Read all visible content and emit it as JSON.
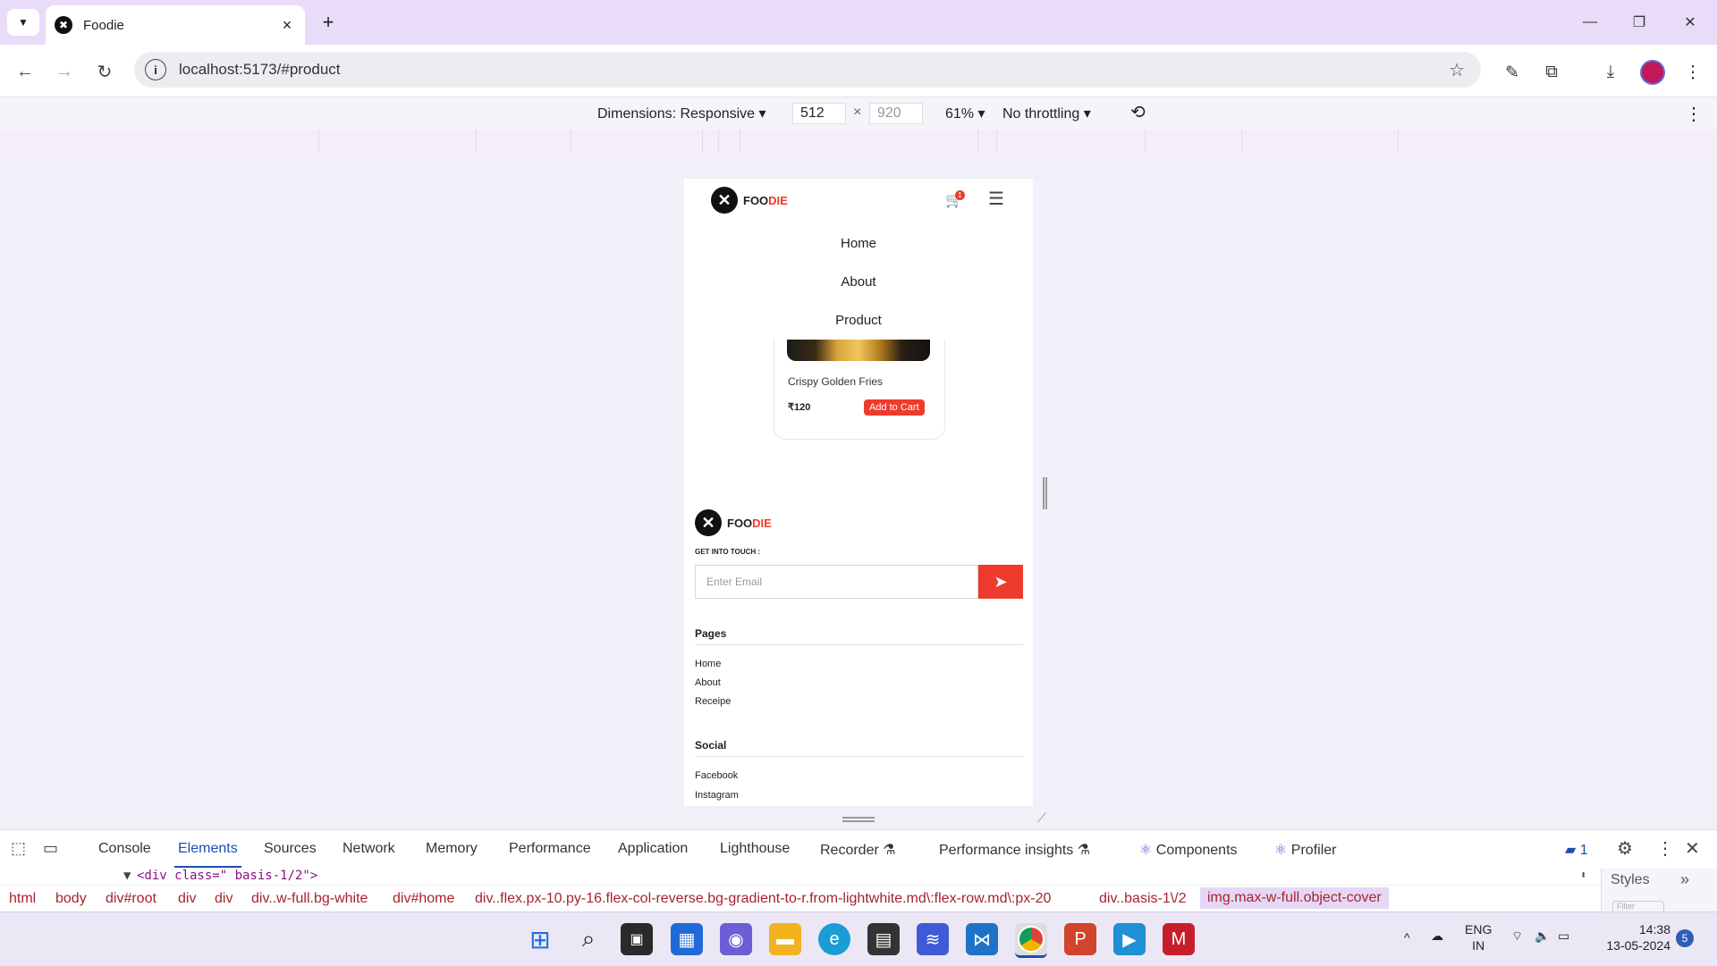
{
  "browser": {
    "tab_title": "Foodie",
    "tab_favicon": "✖",
    "url": "localhost:5173/#product",
    "new_tab": "+",
    "win_min": "—",
    "win_restore": "❐",
    "win_close": "✕"
  },
  "device_toolbar": {
    "dimensions": "Dimensions: Responsive",
    "width": "512",
    "times": "×",
    "height": "920",
    "zoom": "61%",
    "throttle": "No throttling"
  },
  "site": {
    "brand_left": "FOO",
    "brand_right": "DIE",
    "cart_count": "1",
    "menu": [
      "Home",
      "About",
      "Product"
    ],
    "product": {
      "name": "Crispy Golden Fries",
      "price": "₹120",
      "cta": "Add to Cart"
    },
    "footer": {
      "get_in_touch": "GET INTO TOUCH :",
      "email_placeholder": "Enter Email",
      "pages_title": "Pages",
      "pages": [
        "Home",
        "About",
        "Receipe"
      ],
      "social_title": "Social",
      "social": [
        "Facebook",
        "Instagram"
      ]
    }
  },
  "devtools": {
    "tabs": [
      "Console",
      "Elements",
      "Sources",
      "Network",
      "Memory",
      "Performance",
      "Application",
      "Lighthouse",
      "Recorder",
      "Performance insights",
      "Components",
      "Profiler"
    ],
    "active_tab": "Elements",
    "issues_count": "1",
    "code_line": "<div class=\" basis-1/2\">",
    "crumbs": [
      "html",
      "body",
      "div#root",
      "div",
      "div",
      "div..w-full.bg-white",
      "div#home",
      "div..flex.px-10.py-16.flex-col-reverse.bg-gradient-to-r.from-lightwhite.md\\:flex-row.md\\:px-20",
      "div..basis-1\\/2",
      "img.max-w-full.object-cover"
    ],
    "styles_tab": "Styles",
    "filter_placeholder": "Filter"
  },
  "taskbar": {
    "lang": "ENG",
    "region": "IN",
    "time": "14:38",
    "date": "13-05-2024",
    "notif_count": "5"
  },
  "colors": {
    "accent": "#ef3b2d",
    "chrome_frame": "#e9dcf8",
    "devtools_active": "#1a4fb0"
  }
}
